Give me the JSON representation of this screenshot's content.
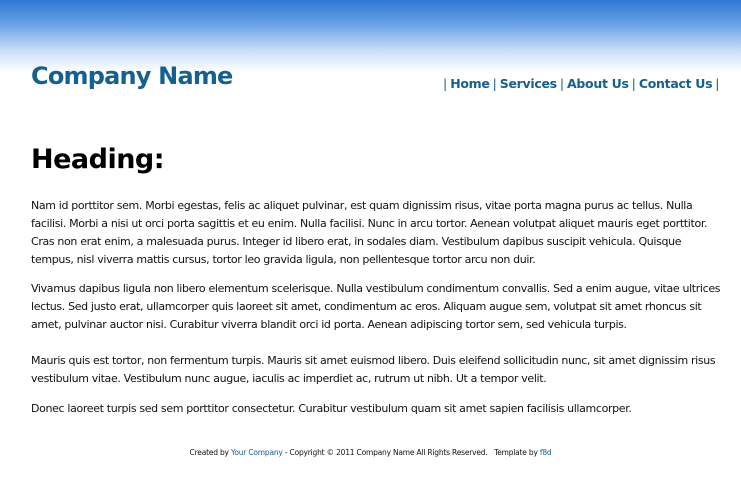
{
  "header": {
    "company_name": "Company Name",
    "nav": [
      {
        "label": "Home"
      },
      {
        "label": "Services"
      },
      {
        "label": "About Us"
      },
      {
        "label": "Contact Us"
      }
    ],
    "separator": "|"
  },
  "main": {
    "heading": "Heading:",
    "paragraphs": [
      "Nam id porttitor sem. Morbi egestas, felis ac aliquet pulvinar, est quam dignissim risus, vitae porta magna purus ac tellus. Nulla facilisi. Morbi a nisi ut orci porta sagittis et eu enim. Nulla facilisi. Nunc in arcu tortor. Aenean volutpat aliquet mauris eget porttitor. Cras non erat enim, a malesuada purus. Integer id libero erat, in sodales diam. Vestibulum dapibus suscipit vehicula. Quisque tempus, nisl viverra mattis cursus, tortor leo gravida ligula, non pellentesque tortor arcu non duir.",
      "Vivamus dapibus ligula non libero elementum scelerisque. Nulla vestibulum condimentum convallis. Sed a enim augue, vitae ultrices lectus. Sed justo erat, ullamcorper quis laoreet sit amet, condimentum ac eros. Aliquam augue sem, volutpat sit amet rhoncus sit amet, pulvinar auctor nisi. Curabitur viverra blandit orci id porta. Aenean adipiscing tortor sem, sed vehicula turpis.",
      "Mauris quis est tortor, non fermentum turpis. Mauris sit amet euismod libero. Duis eleifend sollicitudin nunc, sit amet dignissim risus vestibulum vitae. Vestibulum nunc augue, iaculis ac imperdiet ac, rutrum ut nibh. Ut a tempor velit.",
      "Donec laoreet turpis sed sem porttitor consectetur. Curabitur vestibulum quam sit amet sapien facilisis ullamcorper."
    ]
  },
  "footer": {
    "created_by": "Created by",
    "company_link": "Your Company",
    "copyright": "- Copyright © 2011 Company Name All Rights Reserved.",
    "template_by": "Template by",
    "template_link": "f8d"
  },
  "colors": {
    "brand": "#15608f",
    "gradient_top": "#2f78d2",
    "text": "#111111"
  }
}
